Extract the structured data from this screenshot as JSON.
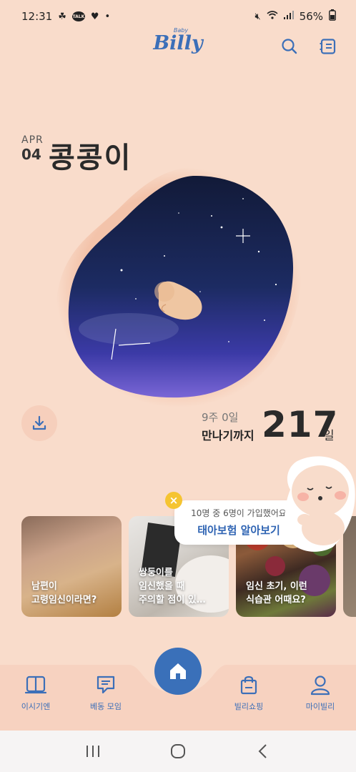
{
  "status_bar": {
    "time": "12:31",
    "battery": "56%",
    "talk_badge": "TALK"
  },
  "header": {
    "logo_small": "Baby",
    "logo_main": "Billy"
  },
  "hero": {
    "month": "APR",
    "day": "04",
    "baby_name": "콩콩이",
    "week_info": "9주 0일",
    "meet_label": "만나기까지",
    "days": "217",
    "days_unit": "일"
  },
  "promo": {
    "subtitle": "10명 중 6명이 가입했어요",
    "title": "태아보험 알아보기",
    "close": "×"
  },
  "cards": [
    {
      "line1": "남편이",
      "line2": "고령임신이라면?"
    },
    {
      "line1": "쌍둥이를",
      "line2": "임신했을 때",
      "line3": "주의할 점이 있…"
    },
    {
      "line1": "임신 초기, 이런",
      "line2": "식습관 어때요?"
    }
  ],
  "nav": {
    "items": [
      {
        "label": "이시기엔"
      },
      {
        "label": "베동 모임"
      },
      {
        "label": "빌리쇼핑"
      },
      {
        "label": "마이빌리"
      }
    ]
  },
  "colors": {
    "background": "#f9dccb",
    "accent": "#3c6fb8",
    "home_button": "#3a70b9"
  }
}
